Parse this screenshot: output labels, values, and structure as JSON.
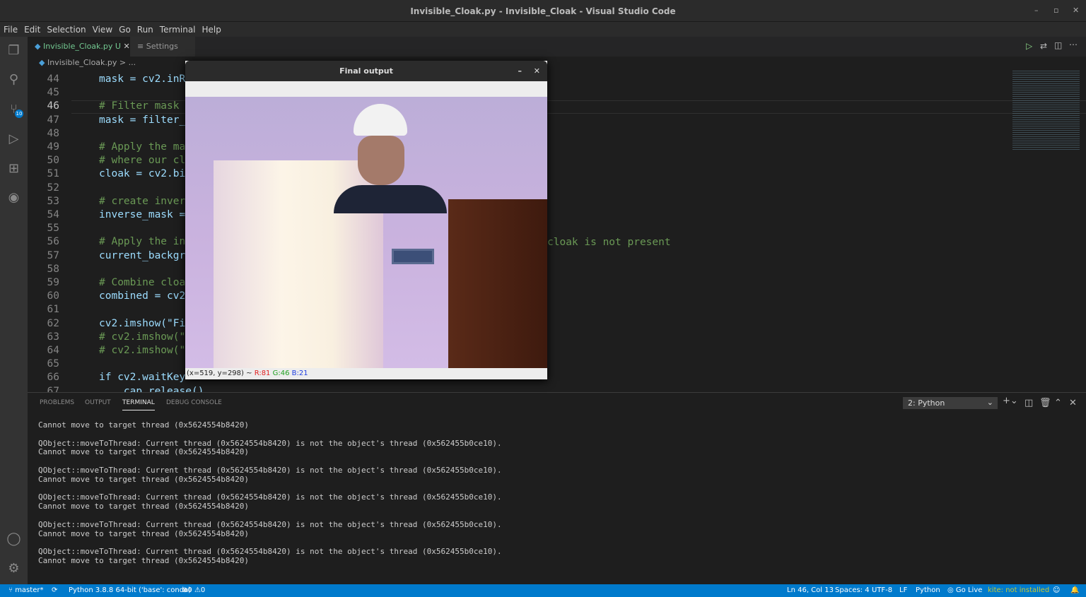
{
  "window": {
    "title": "Invisible_Cloak.py - Invisible_Cloak - Visual Studio Code"
  },
  "menu": [
    "File",
    "Edit",
    "Selection",
    "View",
    "Go",
    "Run",
    "Terminal",
    "Help"
  ],
  "tabs": [
    {
      "label": "Invisible_Cloak.py",
      "badge": "U"
    },
    {
      "label": "Settings"
    }
  ],
  "breadcrumb": "Invisible_Cloak.py > ...",
  "activity_badge": "10",
  "code_lines": [
    {
      "n": "44",
      "text": "mask = cv2.inR"
    },
    {
      "n": "45",
      "text": ""
    },
    {
      "n": "46",
      "text": "# Filter mask"
    },
    {
      "n": "47",
      "text": "mask = filter_"
    },
    {
      "n": "48",
      "text": ""
    },
    {
      "n": "49",
      "text": "# Apply the ma"
    },
    {
      "n": "50",
      "text": "# where our cl"
    },
    {
      "n": "51",
      "text": "cloak = cv2.bi"
    },
    {
      "n": "52",
      "text": ""
    },
    {
      "n": "53",
      "text": "# create inver"
    },
    {
      "n": "54",
      "text": "inverse_mask ="
    },
    {
      "n": "55",
      "text": ""
    },
    {
      "n": "56",
      "text": "# Apply the in"
    },
    {
      "n": "57",
      "text": "current_backgr"
    },
    {
      "n": "58",
      "text": ""
    },
    {
      "n": "59",
      "text": "# Combine cloa"
    },
    {
      "n": "60",
      "text": "combined = cv2"
    },
    {
      "n": "61",
      "text": ""
    },
    {
      "n": "62",
      "text": "cv2.imshow(\"Fi"
    },
    {
      "n": "63",
      "text": "# cv2.imshow(\""
    },
    {
      "n": "64",
      "text": "# cv2.imshow(\""
    },
    {
      "n": "65",
      "text": ""
    },
    {
      "n": "66",
      "text": "if cv2.waitKey"
    },
    {
      "n": "67",
      "text": "    cap.release()"
    }
  ],
  "code_overflow": "cloak is not present",
  "popup": {
    "title": "Final output",
    "coords": "(x=519, y=298) ~",
    "r": "R:81",
    "g": "G:46",
    "b": "B:21"
  },
  "panel": {
    "tabs": [
      "PROBLEMS",
      "OUTPUT",
      "TERMINAL",
      "DEBUG CONSOLE"
    ],
    "terminal_select": "2: Python",
    "lines": [
      "Cannot move to target thread (0x5624554b8420)",
      "",
      "QObject::moveToThread: Current thread (0x5624554b8420) is not the object's thread (0x562455b0ce10).",
      "Cannot move to target thread (0x5624554b8420)",
      "",
      "QObject::moveToThread: Current thread (0x5624554b8420) is not the object's thread (0x562455b0ce10).",
      "Cannot move to target thread (0x5624554b8420)",
      "",
      "QObject::moveToThread: Current thread (0x5624554b8420) is not the object's thread (0x562455b0ce10).",
      "Cannot move to target thread (0x5624554b8420)",
      "",
      "QObject::moveToThread: Current thread (0x5624554b8420) is not the object's thread (0x562455b0ce10).",
      "Cannot move to target thread (0x5624554b8420)",
      "",
      "QObject::moveToThread: Current thread (0x5624554b8420) is not the object's thread (0x562455b0ce10).",
      "Cannot move to target thread (0x5624554b8420)"
    ]
  },
  "status": {
    "branch": "master*",
    "interpreter": "Python 3.8.8 64-bit ('base': conda)",
    "errors": "0",
    "warnings": "0",
    "position": "Ln 46, Col 13",
    "spaces": "Spaces: 4",
    "encoding": "UTF-8",
    "eol": "LF",
    "language": "Python",
    "golive": "Go Live",
    "kite": "kite: not installed"
  },
  "colors": {
    "statusbar": "#007acc",
    "accent_tab": "#73c991",
    "kite": "#c8c832"
  }
}
